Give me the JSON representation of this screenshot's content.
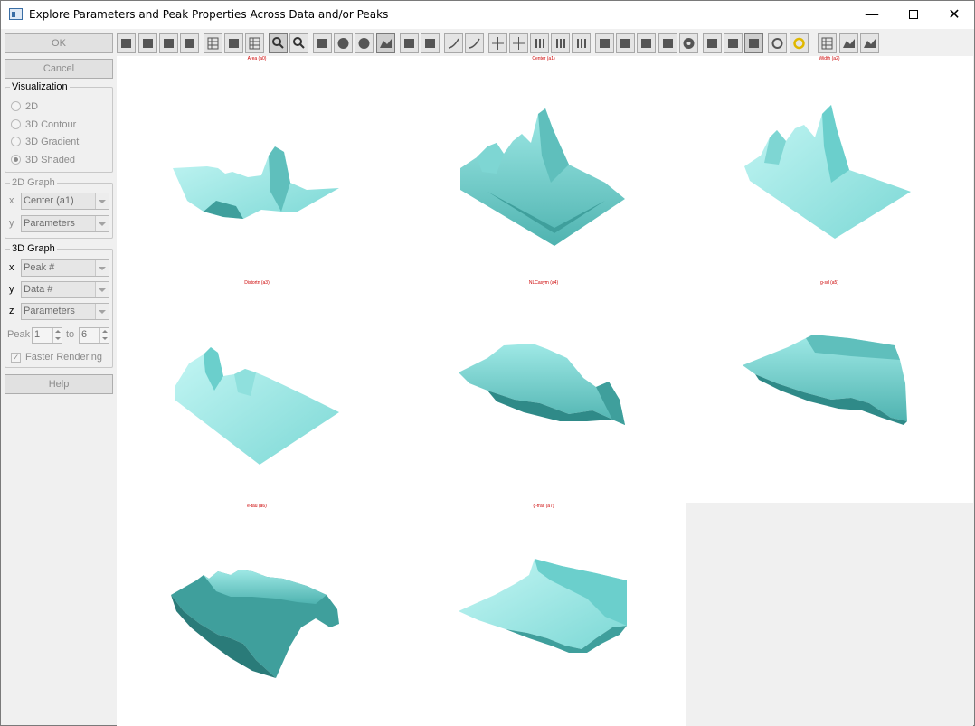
{
  "window": {
    "title": "Explore Parameters and Peak Properties Across Data and/or Peaks",
    "minimize_glyph": "—",
    "close_glyph": "✕"
  },
  "left_panel": {
    "ok_label": "OK",
    "cancel_label": "Cancel",
    "help_label": "Help",
    "visualization": {
      "label": "Visualization",
      "options": [
        "2D",
        "3D Contour",
        "3D Gradient",
        "3D Shaded"
      ],
      "selected": "3D Shaded"
    },
    "graph2d": {
      "label": "2D Graph",
      "x_axis": "x",
      "x_value": "Center (a1)",
      "y_axis": "y",
      "y_value": "Parameters"
    },
    "graph3d": {
      "label": "3D Graph",
      "x_axis": "x",
      "x_value": "Peak #",
      "y_axis": "y",
      "y_value": "Data #",
      "z_axis": "z",
      "z_value": "Parameters",
      "peak_label": "Peak",
      "peak_from": "1",
      "to_label": "to",
      "peak_to": "6",
      "faster_rendering_label": "Faster Rendering",
      "faster_rendering_checked": true
    }
  },
  "toolbar": {
    "icons": [
      "print-icon",
      "clipboard-icon",
      "save-icon",
      "word-icon",
      "grid-small-icon",
      "square-icon",
      "table-grid-icon",
      "zoom-in-icon",
      "zoom-out-icon",
      "box-icon",
      "blob-icon",
      "shape-icon",
      "surface-icon",
      "axis-plus-icon",
      "axis-box-icon",
      "curve-icon",
      "curve2-icon",
      "crosshair-icon",
      "crosshair2-icon",
      "bars-icon",
      "lines-icon",
      "lines2-icon",
      "binoculars-icon",
      "scatter-icon",
      "monitor-icon",
      "font-icon",
      "target-icon",
      "solid-icon",
      "solid2-icon",
      "vertical-bar-icon",
      "rotate-icon",
      "rotate-yellow-icon",
      "grid-dots-icon",
      "terrain-icon",
      "wire-surface-icon"
    ]
  },
  "plots": [
    {
      "title": "Area (a0)"
    },
    {
      "title": "Center (a1)"
    },
    {
      "title": "Width (a2)"
    },
    {
      "title": "Distortn (a3)"
    },
    {
      "title": "NLCasym (a4)"
    },
    {
      "title": "g-sd (a5)"
    },
    {
      "title": "e-tau (a6)"
    },
    {
      "title": "g-frac (a7)"
    }
  ],
  "colors": {
    "surface_light": "#a8ecea",
    "surface_mid": "#6bcfcc",
    "surface_dark": "#2f8a88",
    "title_red": "#cc0000"
  }
}
